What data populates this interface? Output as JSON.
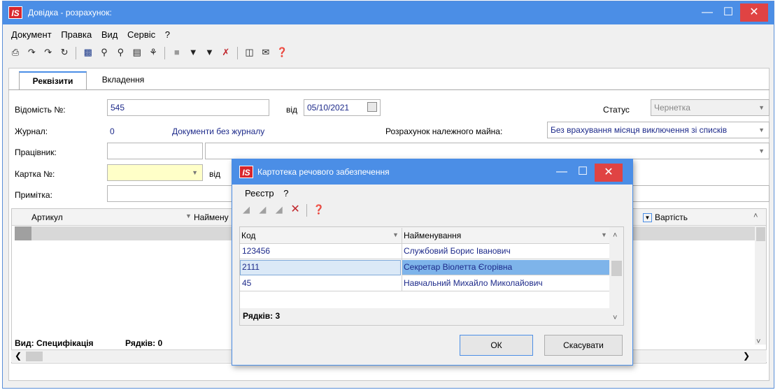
{
  "window": {
    "title": "Довідка - розрахунок:",
    "logo": "IS"
  },
  "menu": [
    "Документ",
    "Правка",
    "Вид",
    "Сервіс",
    "?"
  ],
  "toolbar_icons": [
    "print-icon",
    "add-icon",
    "copy-icon",
    "refresh-icon",
    "save-icon",
    "find-icon",
    "find-next-icon",
    "report-icon",
    "tree-icon",
    "grey-box-icon",
    "filter-icon",
    "filter-add-icon",
    "filter-clear-icon",
    "form-icon",
    "mail-icon",
    "help-icon"
  ],
  "tabs": [
    "Реквізити",
    "Вкладення"
  ],
  "form": {
    "vidomist_label": "Відомість №:",
    "vidomist_value": "545",
    "vid_label": "від",
    "date_value": "05/10/2021",
    "status_label": "Статус",
    "status_value": "Чернетка",
    "zhurnal_label": "Журнал:",
    "zhurnal_value": "0",
    "zhurnal_name": "Документи без журналу",
    "rozrakhunok_label": "Розрахунок належного майна:",
    "rozrakhunok_value": "Без врахування місяця виключення зі списків",
    "pratsivnyk_label": "Працівник:",
    "kartka_label": "Картка №:",
    "kartka_vid_label": "від",
    "prymitka_label": "Примітка:"
  },
  "grid": {
    "col_artykul": "Артикул",
    "col_naymenuvannia": "Наймену",
    "col_vartist": "Вартість",
    "footer_view": "Вид: Специфікація",
    "footer_rows": "Рядків: 0"
  },
  "dialog": {
    "title": "Картотека речового забезпечення",
    "logo": "IS",
    "menu": [
      "Реєстр",
      "?"
    ],
    "col_kod": "Код",
    "col_name": "Найменування",
    "rows": [
      {
        "kod": "123456",
        "name": "Службовий Борис Іванович"
      },
      {
        "kod": "2111",
        "name": "Секретар Віолетта Єгорівна"
      },
      {
        "kod": "45",
        "name": "Навчальний Михайло Миколайович"
      }
    ],
    "rows_count": "Рядків: 3",
    "ok_label": "ОК",
    "cancel_label": "Скасувати"
  }
}
